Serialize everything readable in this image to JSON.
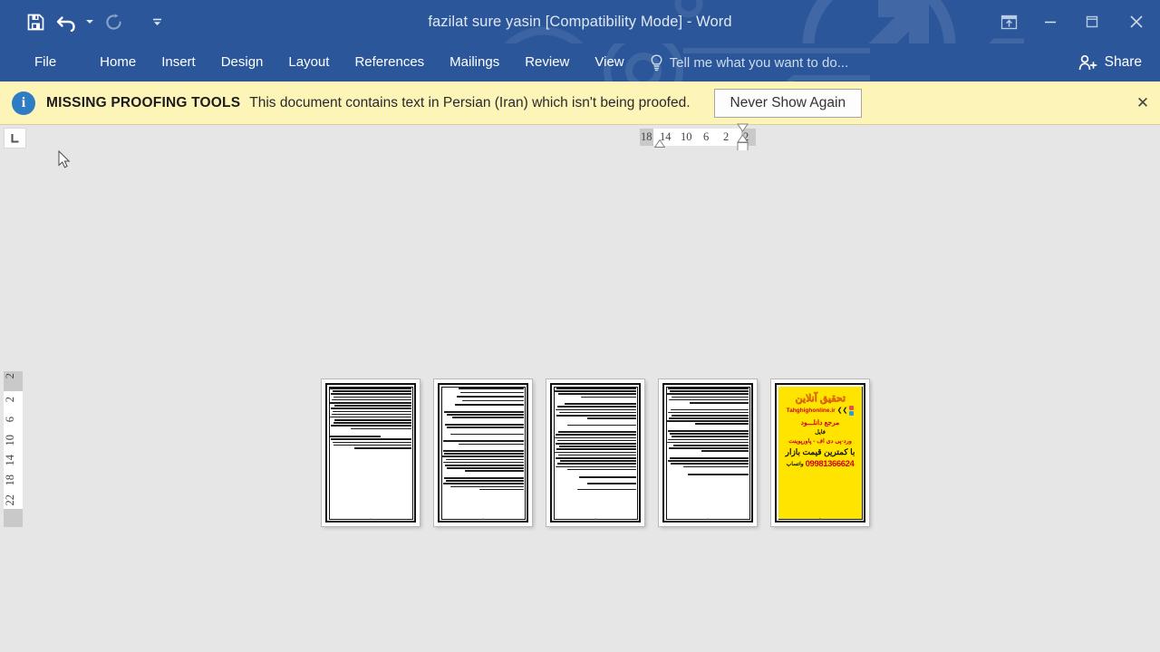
{
  "window": {
    "title": "fazilat sure yasin [Compatibility Mode] - Word",
    "quick_access": [
      {
        "name": "save",
        "icon": "save-icon",
        "enabled": true
      },
      {
        "name": "undo",
        "icon": "undo-icon",
        "enabled": true
      },
      {
        "name": "undo-dropdown",
        "icon": "chevron-down-icon",
        "enabled": true
      },
      {
        "name": "redo",
        "icon": "redo-icon",
        "enabled": false
      },
      {
        "name": "customize-quick-access",
        "icon": "chevron-down-icon",
        "enabled": true
      }
    ],
    "controls": {
      "ribbon_display": "ribbon-display-options-icon",
      "minimize": "minimize-icon",
      "maximize": "maximize-icon",
      "close": "close-icon"
    }
  },
  "ribbon": {
    "tabs": [
      {
        "label": "File",
        "active": false
      },
      {
        "label": "Home",
        "active": false
      },
      {
        "label": "Insert",
        "active": false
      },
      {
        "label": "Design",
        "active": false
      },
      {
        "label": "Layout",
        "active": false
      },
      {
        "label": "References",
        "active": false
      },
      {
        "label": "Mailings",
        "active": false
      },
      {
        "label": "Review",
        "active": false
      },
      {
        "label": "View",
        "active": false
      }
    ],
    "tell_me_placeholder": "Tell me what you want to do...",
    "share_label": "Share"
  },
  "message_bar": {
    "icon": "info-icon",
    "title": "MISSING PROOFING TOOLS",
    "text": "This document contains text in Persian (Iran) which isn't being proofed.",
    "button_label": "Never Show Again",
    "close_label": "✕",
    "background": "#fdf4b8"
  },
  "rulers": {
    "tab_stop_selector": "L",
    "horizontal_ticks": [
      "18",
      "14",
      "10",
      "6",
      "2",
      "2"
    ],
    "vertical_ticks": [
      "2",
      "6",
      "10",
      "14",
      "18",
      "22"
    ],
    "vertical_top_tick": "2"
  },
  "document": {
    "zoom_view": "multiple-pages",
    "pages": [
      {
        "index": 1,
        "type": "text",
        "page_label": "1"
      },
      {
        "index": 2,
        "type": "text",
        "page_label": "2"
      },
      {
        "index": 3,
        "type": "text",
        "page_label": "3"
      },
      {
        "index": 4,
        "type": "text",
        "page_label": "4"
      },
      {
        "index": 5,
        "type": "advertisement",
        "page_label": "5"
      }
    ],
    "ad_page": {
      "headline": "تحقیق آنلاین",
      "url": "Tahghighonline.ir",
      "line1": "مرجع دانلـــود",
      "line2": "فایل",
      "line3": "ورد-پی دی اف - پاورپوینت",
      "line4": "با کمترین قیمت بازار",
      "phone": "09981366624",
      "whatsapp_label": "واتساپ",
      "background": "#ffe400"
    }
  },
  "colors": {
    "ribbon_blue": "#2b579a",
    "workspace_gray": "#e6e6e6",
    "message_yellow": "#fdf4b8",
    "accent_red": "#d0021b"
  }
}
